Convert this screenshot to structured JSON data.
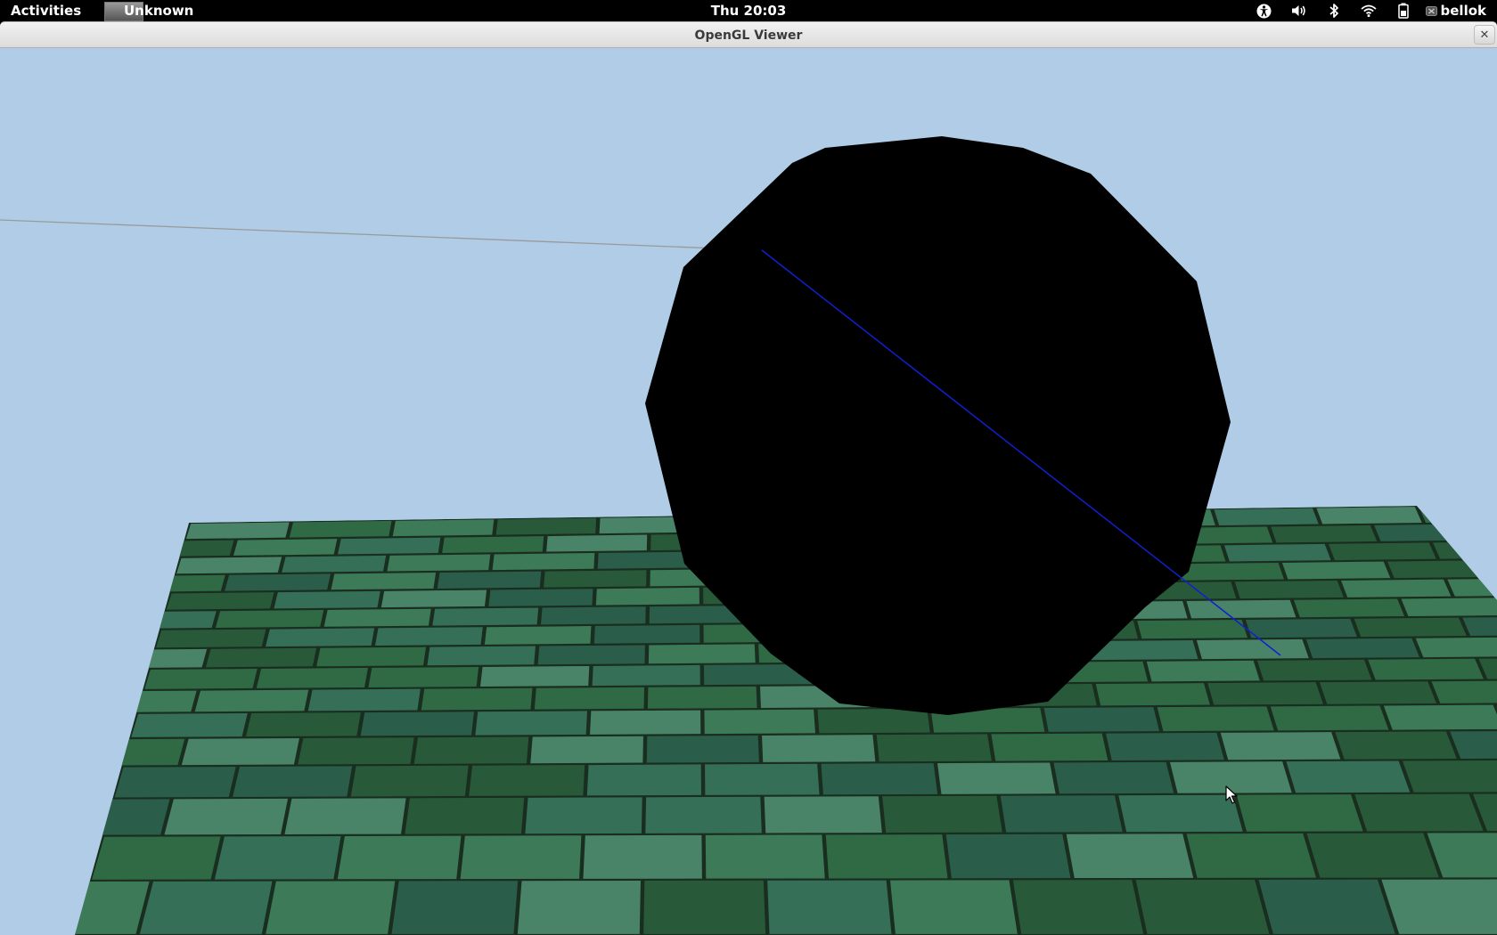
{
  "topbar": {
    "activities_label": "Activities",
    "app_name": "Unknown",
    "clock": "Thu 20:03",
    "tray_icons": [
      "accessibility-icon",
      "volume-icon",
      "bluetooth-icon",
      "wifi-icon",
      "battery-icon"
    ],
    "user_name": "bellok"
  },
  "window": {
    "title": "OpenGL Viewer",
    "close_glyph": "✕"
  },
  "scene": {
    "sky_color": "#b0cce6",
    "sphere_color": "#000000",
    "floor_tile_colors": [
      "#2f6a45",
      "#3d7a58",
      "#285a3a",
      "#4a8468",
      "#356f58",
      "#2a5e4a"
    ],
    "grout_color": "#1a2e20",
    "ray_color_outside": "#9a9a9a",
    "ray_color_inside": "#1020d0"
  }
}
